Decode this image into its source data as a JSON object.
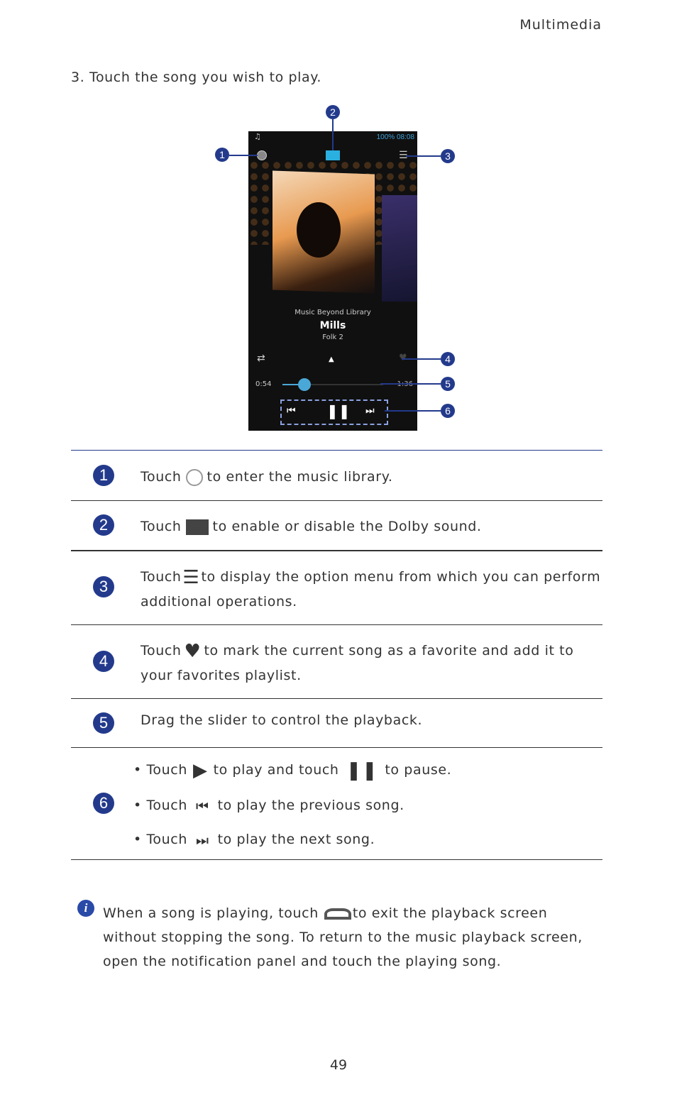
{
  "header": {
    "section": "Multimedia"
  },
  "step": "3. Touch the song you wish to play.",
  "phone": {
    "status_time": "08:08",
    "battery": "100%",
    "album": "Music Beyond Library",
    "title": "Mills",
    "artist": "Folk 2",
    "elapsed": "0:54",
    "remaining": "1:36",
    "progress_percent": 22
  },
  "callouts": [
    "1",
    "2",
    "3",
    "4",
    "5",
    "6"
  ],
  "rows": [
    {
      "num": "1",
      "before": "Touch",
      "icon": "disc-icon",
      "after": "to enter the music library."
    },
    {
      "num": "2",
      "before": "Touch",
      "icon": "dolby-icon",
      "after": "to enable or disable the Dolby sound."
    },
    {
      "num": "3",
      "before": "Touch",
      "icon": "menu-icon",
      "after": "to display the option menu from which you can perform additional operations."
    },
    {
      "num": "4",
      "before": "Touch",
      "icon": "heart-icon",
      "after": "to mark the current song as a favorite and add it to your favorites playlist."
    },
    {
      "num": "5",
      "text": "Drag the slider to control the playback."
    }
  ],
  "row6": {
    "num": "6",
    "bullets": [
      {
        "before": "Touch",
        "mid": "to play and touch",
        "after": "to pause."
      },
      {
        "before": "Touch",
        "after": "to play the previous song."
      },
      {
        "before": "Touch",
        "after": "to play the next song."
      }
    ]
  },
  "note": {
    "before": "When a song is playing, touch",
    "after": "to exit the playback screen without stopping the song. To return to the music playback screen, open the notification panel and touch the playing song."
  },
  "page_number": "49",
  "colors": {
    "accent": "#233a8c",
    "slider": "#4aa8d8"
  }
}
